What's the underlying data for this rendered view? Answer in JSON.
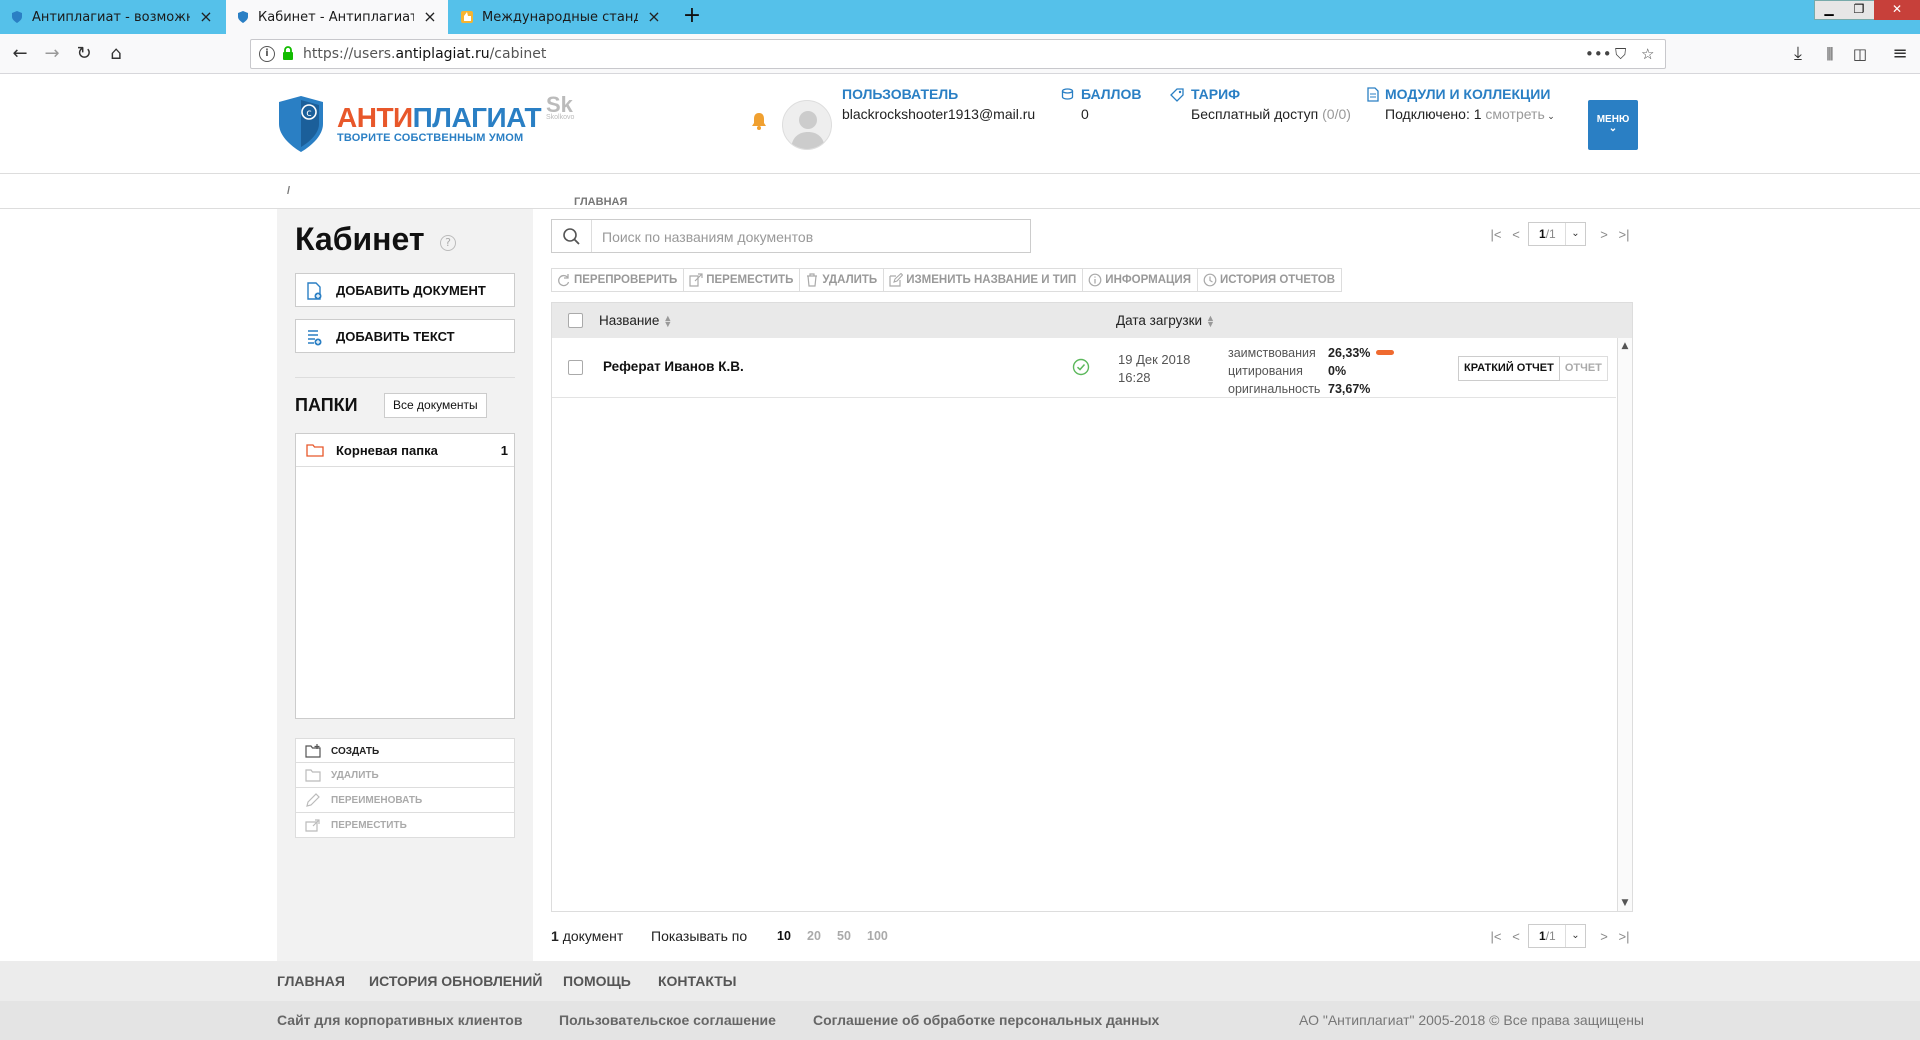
{
  "browser": {
    "tabs": [
      {
        "title": "Антиплагиат - возможность п"
      },
      {
        "title": "Кабинет - Антиплагиат"
      },
      {
        "title": "Международные стандарты на"
      }
    ],
    "url_prefix": "https://users.",
    "url_domain": "antiplagiat.ru",
    "url_path": "/cabinet"
  },
  "header": {
    "logo_part1": "АНТИ",
    "logo_part2": "ПЛАГИАТ",
    "logo_tagline": "ТВОРИТЕ СОБСТВЕННЫМ УМОМ",
    "sk_logo": "Sk",
    "sk_sub": "Skolkovo",
    "user_label": "ПОЛЬЗОВАТЕЛЬ",
    "user_email": "blackrockshooter1913@mail.ru",
    "points_label": "БАЛЛОВ",
    "points_value": "0",
    "tariff_label": "ТАРИФ",
    "tariff_value": "Бесплатный доступ",
    "tariff_quota": "(0/0)",
    "modules_label": "МОДУЛИ И КОЛЛЕКЦИИ",
    "modules_connected": "Подключено: 1",
    "modules_view": "смотреть",
    "menu_label": "МЕНЮ",
    "accent_color": "#2a7fc4",
    "brand_orange": "#e8572a"
  },
  "breadcrumb": {
    "home": "ГЛАВНАЯ",
    "sep": "/"
  },
  "sidebar": {
    "title": "Кабинет",
    "help": "?",
    "add_document": "ДОБАВИТЬ ДОКУМЕНТ",
    "add_text": "ДОБАВИТЬ ТЕКСТ",
    "folders_label": "ПАПКИ",
    "all_docs": "Все документы",
    "folders": [
      {
        "name": "Корневая папка",
        "count": "1"
      }
    ],
    "folder_actions": {
      "create": "СОЗДАТЬ",
      "delete": "УДАЛИТЬ",
      "rename": "ПЕРЕИМЕНОВАТЬ",
      "move": "ПЕРЕМЕСТИТЬ"
    }
  },
  "main": {
    "search_placeholder": "Поиск по названиям документов",
    "pager_top": {
      "page": "1",
      "total": "/1"
    },
    "toolbar": {
      "recheck": "ПЕРЕПРОВЕРИТЬ",
      "move": "ПЕРЕМЕСТИТЬ",
      "delete": "УДАЛИТЬ",
      "rename": "ИЗМЕНИТЬ НАЗВАНИЕ И ТИП",
      "info": "ИНФОРМАЦИЯ",
      "history": "ИСТОРИЯ ОТЧЕТОВ"
    },
    "columns": {
      "name": "Название",
      "date": "Дата загрузки"
    },
    "documents": [
      {
        "title": "Реферат Иванов К.В.",
        "date": "19 Дек 2018",
        "time": "16:28",
        "borrow_label": "заимствования",
        "borrow_value": "26,33%",
        "cite_label": "цитирования",
        "cite_value": "0%",
        "orig_label": "оригинальность",
        "orig_value": "73,67%",
        "short_report": "КРАТКИЙ ОТЧЕТ",
        "report": "ОТЧЕТ"
      }
    ],
    "footer": {
      "count_num": "1",
      "count_word": "документ",
      "show_by": "Показывать по",
      "page_sizes": [
        "10",
        "20",
        "50",
        "100"
      ],
      "active_size": "10"
    },
    "pager_bottom": {
      "page": "1",
      "total": "/1"
    }
  },
  "footer": {
    "nav": [
      "ГЛАВНАЯ",
      "ИСТОРИЯ ОБНОВЛЕНИЙ",
      "ПОМОЩЬ",
      "КОНТАКТЫ"
    ],
    "links": [
      "Сайт для корпоративных клиентов",
      "Пользовательское соглашение",
      "Соглашение об обработке персональных данных"
    ],
    "copyright": "АО \"Антиплагиат\" 2005-2018 © Все права защищены"
  }
}
